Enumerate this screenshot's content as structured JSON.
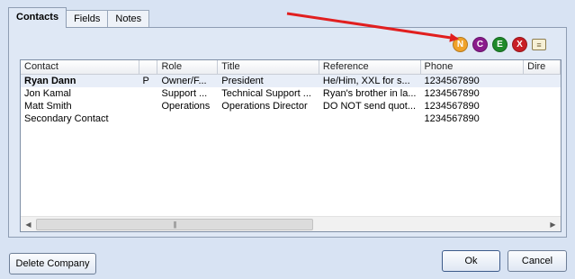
{
  "tabs": [
    {
      "label": "Contacts",
      "active": true
    },
    {
      "label": "Fields",
      "active": false
    },
    {
      "label": "Notes",
      "active": false
    }
  ],
  "toolbar": {
    "new_glyph": "N",
    "copy_glyph": "C",
    "edit_glyph": "E",
    "delete_glyph": "X",
    "card_glyph": "≡"
  },
  "contacts_table": {
    "columns": [
      "Contact",
      "",
      "Role",
      "Title",
      "Reference",
      "Phone",
      "Dire"
    ],
    "rows": [
      [
        "Ryan Dann",
        "P",
        "Owner/F...",
        "President",
        "He/Him, XXL for s...",
        "1234567890",
        ""
      ],
      [
        "Jon Kamal",
        "",
        "Support ...",
        "Technical Support ...",
        "Ryan's brother in la...",
        "1234567890",
        ""
      ],
      [
        "Matt Smith",
        "",
        "Operations",
        "Operations Director",
        "DO NOT send quot...",
        "1234567890",
        ""
      ],
      [
        "Secondary Contact",
        "",
        "",
        "",
        "",
        "1234567890",
        ""
      ]
    ],
    "selected_row": 0
  },
  "scrollbar": {
    "left_arrow": "◀",
    "right_arrow": "▶",
    "thumb_grip": "|||"
  },
  "buttons": {
    "delete_company": "Delete Company",
    "ok": "Ok",
    "cancel": "Cancel"
  },
  "colors": {
    "annotation_arrow": "#e11f1f"
  }
}
